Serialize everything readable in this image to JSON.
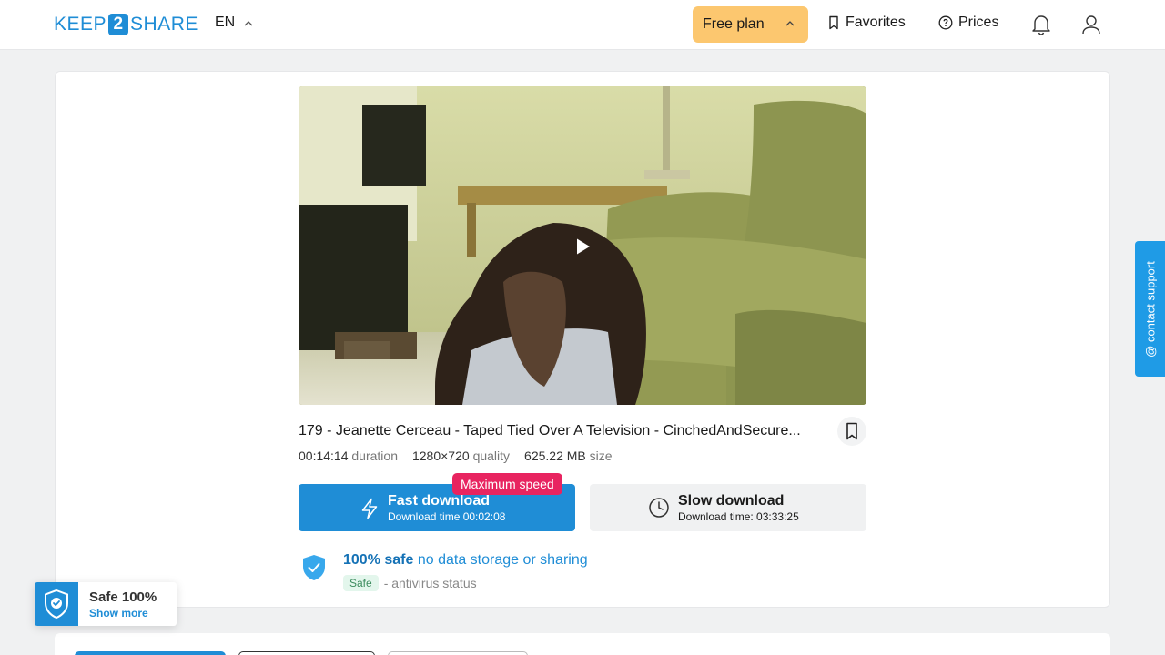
{
  "header": {
    "logo_left": "KEEP",
    "logo_mid": "2",
    "logo_right": "SHARE",
    "language": "EN",
    "free_plan": "Free plan",
    "favorites": "Favorites",
    "prices": "Prices"
  },
  "file": {
    "title": "179 - Jeanette Cerceau - Taped Tied Over A Television - CinchedAndSecure...",
    "duration_value": "00:14:14",
    "duration_label": "duration",
    "quality_value": "1280×720",
    "quality_label": "quality",
    "size_value": "625.22 MB",
    "size_label": "size"
  },
  "downloads": {
    "badge": "Maximum speed",
    "fast_label": "Fast download",
    "fast_time": "Download time 00:02:08",
    "slow_label": "Slow download",
    "slow_time": "Download time: 03:33:25"
  },
  "safety": {
    "strong": "100% safe",
    "rest": "no data storage or sharing",
    "badge": "Safe",
    "status": "- antivirus status"
  },
  "widget": {
    "title": "Safe 100%",
    "link": "Show more"
  },
  "support": {
    "label": "@ contact support"
  },
  "colors": {
    "brand": "#1f8dd6",
    "free_plan": "#fcc76f",
    "badge": "#e82460"
  }
}
